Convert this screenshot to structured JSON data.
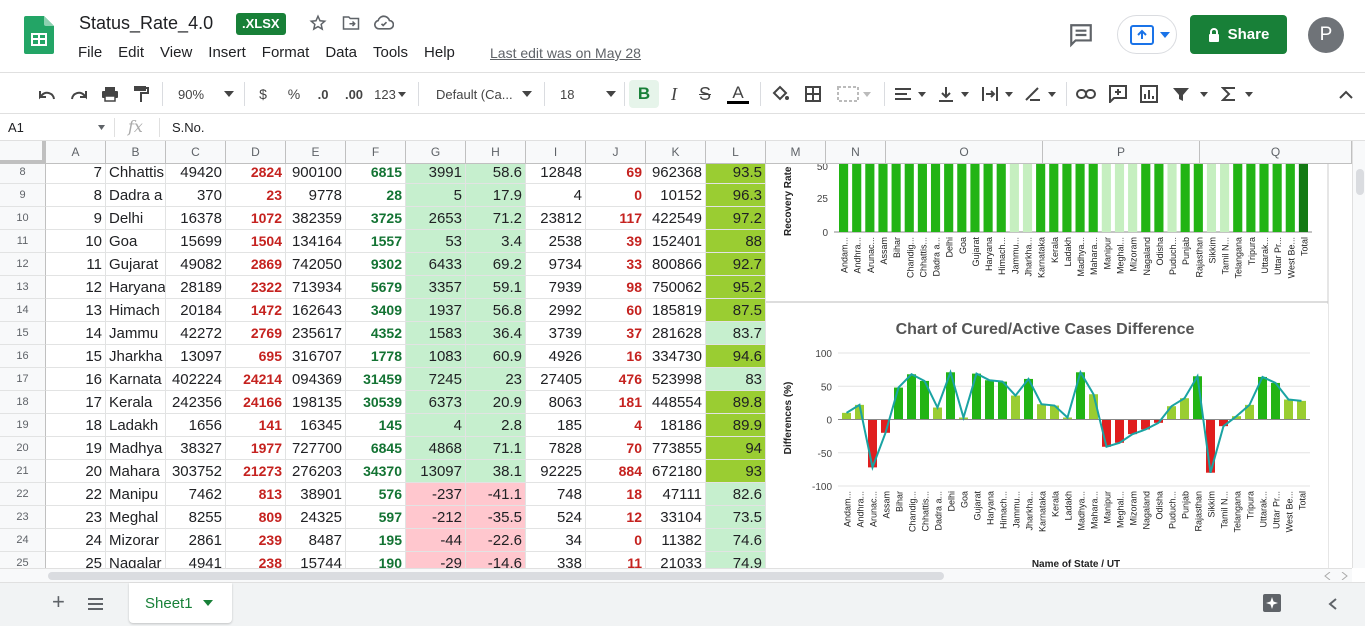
{
  "doc": {
    "title": "Status_Rate_4.0",
    "badge": ".XLSX",
    "last_edit": "Last edit was on May 28"
  },
  "menu": [
    "File",
    "Edit",
    "View",
    "Insert",
    "Format",
    "Data",
    "Tools",
    "Help"
  ],
  "header_buttons": {
    "share": "Share",
    "avatar": "P"
  },
  "toolbar": {
    "zoom": "90%",
    "currency": "$",
    "percent": "%",
    "dec_decrease": ".0",
    "dec_increase": ".00",
    "more_formats": "123",
    "font": "Default (Ca...",
    "font_size": "18",
    "bold": "B",
    "italic": "I",
    "strike": "S",
    "text_color": "A"
  },
  "formula_bar": {
    "cell": "A1",
    "fx": "fx",
    "value": "S.No."
  },
  "columns": [
    "A",
    "B",
    "C",
    "D",
    "E",
    "F",
    "G",
    "H",
    "I",
    "J",
    "K",
    "L",
    "M",
    "N",
    "O",
    "P",
    "Q"
  ],
  "rows": [
    {
      "n": "8",
      "a": "7",
      "b": "Chhattis",
      "c": "49420",
      "d": "2824",
      "e": "900100",
      "f": "6815",
      "g": "3991",
      "h": "58.6",
      "i": "12848",
      "j": "69",
      "k": "962368",
      "l": "93.5"
    },
    {
      "n": "9",
      "a": "8",
      "b": "Dadra a",
      "c": "370",
      "d": "23",
      "e": "9778",
      "f": "28",
      "g": "5",
      "h": "17.9",
      "i": "4",
      "j": "0",
      "k": "10152",
      "l": "96.3"
    },
    {
      "n": "10",
      "a": "9",
      "b": "Delhi",
      "c": "16378",
      "d": "1072",
      "e": "382359",
      "f": "3725",
      "g": "2653",
      "h": "71.2",
      "i": "23812",
      "j": "117",
      "k": "422549",
      "l": "97.2"
    },
    {
      "n": "11",
      "a": "10",
      "b": "Goa",
      "c": "15699",
      "d": "1504",
      "e": "134164",
      "f": "1557",
      "g": "53",
      "h": "3.4",
      "i": "2538",
      "j": "39",
      "k": "152401",
      "l": "88"
    },
    {
      "n": "12",
      "a": "11",
      "b": "Gujarat",
      "c": "49082",
      "d": "2869",
      "e": "742050",
      "f": "9302",
      "g": "6433",
      "h": "69.2",
      "i": "9734",
      "j": "33",
      "k": "800866",
      "l": "92.7"
    },
    {
      "n": "13",
      "a": "12",
      "b": "Haryana",
      "c": "28189",
      "d": "2322",
      "e": "713934",
      "f": "5679",
      "g": "3357",
      "h": "59.1",
      "i": "7939",
      "j": "98",
      "k": "750062",
      "l": "95.2"
    },
    {
      "n": "14",
      "a": "13",
      "b": "Himach",
      "c": "20184",
      "d": "1472",
      "e": "162643",
      "f": "3409",
      "g": "1937",
      "h": "56.8",
      "i": "2992",
      "j": "60",
      "k": "185819",
      "l": "87.5"
    },
    {
      "n": "15",
      "a": "14",
      "b": "Jammu",
      "c": "42272",
      "d": "2769",
      "e": "235617",
      "f": "4352",
      "g": "1583",
      "h": "36.4",
      "i": "3739",
      "j": "37",
      "k": "281628",
      "l": "83.7"
    },
    {
      "n": "16",
      "a": "15",
      "b": "Jharkha",
      "c": "13097",
      "d": "695",
      "e": "316707",
      "f": "1778",
      "g": "1083",
      "h": "60.9",
      "i": "4926",
      "j": "16",
      "k": "334730",
      "l": "94.6"
    },
    {
      "n": "17",
      "a": "16",
      "b": "Karnata",
      "c": "402224",
      "d": "24214",
      "e": "094369",
      "f": "31459",
      "g": "7245",
      "h": "23",
      "i": "27405",
      "j": "476",
      "k": "523998",
      "l": "83"
    },
    {
      "n": "18",
      "a": "17",
      "b": "Kerala",
      "c": "242356",
      "d": "24166",
      "e": "198135",
      "f": "30539",
      "g": "6373",
      "h": "20.9",
      "i": "8063",
      "j": "181",
      "k": "448554",
      "l": "89.8"
    },
    {
      "n": "19",
      "a": "18",
      "b": "Ladakh",
      "c": "1656",
      "d": "141",
      "e": "16345",
      "f": "145",
      "g": "4",
      "h": "2.8",
      "i": "185",
      "j": "4",
      "k": "18186",
      "l": "89.9"
    },
    {
      "n": "20",
      "a": "19",
      "b": "Madhya",
      "c": "38327",
      "d": "1977",
      "e": "727700",
      "f": "6845",
      "g": "4868",
      "h": "71.1",
      "i": "7828",
      "j": "70",
      "k": "773855",
      "l": "94"
    },
    {
      "n": "21",
      "a": "20",
      "b": "Mahara",
      "c": "303752",
      "d": "21273",
      "e": "276203",
      "f": "34370",
      "g": "13097",
      "h": "38.1",
      "i": "92225",
      "j": "884",
      "k": "672180",
      "l": "93"
    },
    {
      "n": "22",
      "a": "22",
      "b": "Manipu",
      "c": "7462",
      "d": "813",
      "e": "38901",
      "f": "576",
      "g": "-237",
      "h": "-41.1",
      "i": "748",
      "j": "18",
      "k": "47111",
      "l": "82.6"
    },
    {
      "n": "23",
      "a": "23",
      "b": "Meghal",
      "c": "8255",
      "d": "809",
      "e": "24325",
      "f": "597",
      "g": "-212",
      "h": "-35.5",
      "i": "524",
      "j": "12",
      "k": "33104",
      "l": "73.5"
    },
    {
      "n": "24",
      "a": "24",
      "b": "Mizorar",
      "c": "2861",
      "d": "239",
      "e": "8487",
      "f": "195",
      "g": "-44",
      "h": "-22.6",
      "i": "34",
      "j": "0",
      "k": "11382",
      "l": "74.6"
    },
    {
      "n": "25",
      "a": "25",
      "b": "Nagalar",
      "c": "4941",
      "d": "238",
      "e": "15744",
      "f": "190",
      "g": "-29",
      "h": "-14.6",
      "i": "338",
      "j": "11",
      "k": "21033",
      "l": "74.9"
    }
  ],
  "l_colors": [
    "#9acd32",
    "#9acd32",
    "#9acd32",
    "#9acd32",
    "#9acd32",
    "#9acd32",
    "#9acd32",
    "#c6efce",
    "#9acd32",
    "#c6efce",
    "#9acd32",
    "#9acd32",
    "#9acd32",
    "#9acd32",
    "#c6efce",
    "#c6efce",
    "#c6efce",
    "#c6efce"
  ],
  "g_colors": [
    "#c6efce",
    "#c6efce",
    "#c6efce",
    "#c6efce",
    "#c6efce",
    "#c6efce",
    "#c6efce",
    "#c6efce",
    "#c6efce",
    "#c6efce",
    "#c6efce",
    "#c6efce",
    "#c6efce",
    "#c6efce",
    "#ffc7ce",
    "#ffc7ce",
    "#ffc7ce",
    "#ffc7ce"
  ],
  "chart_data": [
    {
      "type": "bar",
      "ylabel": "Recovery Rate",
      "yticks": [
        "50",
        "25",
        "0"
      ],
      "categories": [
        "Andam...",
        "Andhra...",
        "Arunac...",
        "Assam",
        "Bihar",
        "Chandig...",
        "Chhattis...",
        "Dadra a...",
        "Delhi",
        "Goa",
        "Gujarat",
        "Haryana",
        "Himach...",
        "Jammu...",
        "Jharkha...",
        "Karnataka",
        "Kerala",
        "Ladakh",
        "Madhya...",
        "Mahara...",
        "Manipur",
        "Meghal...",
        "Mizoram",
        "Nagaland",
        "Odisha",
        "Puduch...",
        "Punjab",
        "Rajasthan",
        "Sikkim",
        "Tamil N...",
        "Telangana",
        "Tripura",
        "Uttarak...",
        "Uttar Pr...",
        "West Be...",
        "Total"
      ]
    },
    {
      "type": "bar",
      "title": "Chart of Cured/Active Cases Difference",
      "ylabel": "Differences (%)",
      "xlabel": "Name of State / UT",
      "yticks": [
        "100",
        "50",
        "0",
        "-50",
        "-100"
      ],
      "ylim": [
        -100,
        100
      ],
      "categories": [
        "Andam...",
        "Andhra...",
        "Arunac...",
        "Assam",
        "Bihar",
        "Chandig...",
        "Chhattis...",
        "Dadra a...",
        "Delhi",
        "Goa",
        "Gujarat",
        "Haryana",
        "Himach...",
        "Jammu...",
        "Jharkha...",
        "Karnataka",
        "Kerala",
        "Ladakh",
        "Madhya...",
        "Mahara...",
        "Manipur",
        "Meghal...",
        "Mizoram",
        "Nagaland",
        "Odisha",
        "Puduch...",
        "Punjab",
        "Rajasthan",
        "Sikkim",
        "Tamil N...",
        "Telangana",
        "Tripura",
        "Uttarak...",
        "Uttar Pr...",
        "West Be...",
        "Total"
      ],
      "values": [
        10,
        22,
        -72,
        -20,
        48,
        68,
        58,
        18,
        71,
        3,
        69,
        59,
        57,
        36,
        61,
        23,
        21,
        3,
        71,
        38,
        -41,
        -35,
        -22,
        -15,
        -5,
        20,
        32,
        65,
        -80,
        -10,
        5,
        22,
        64,
        55,
        30,
        28
      ]
    }
  ],
  "sheet": {
    "name": "Sheet1"
  }
}
